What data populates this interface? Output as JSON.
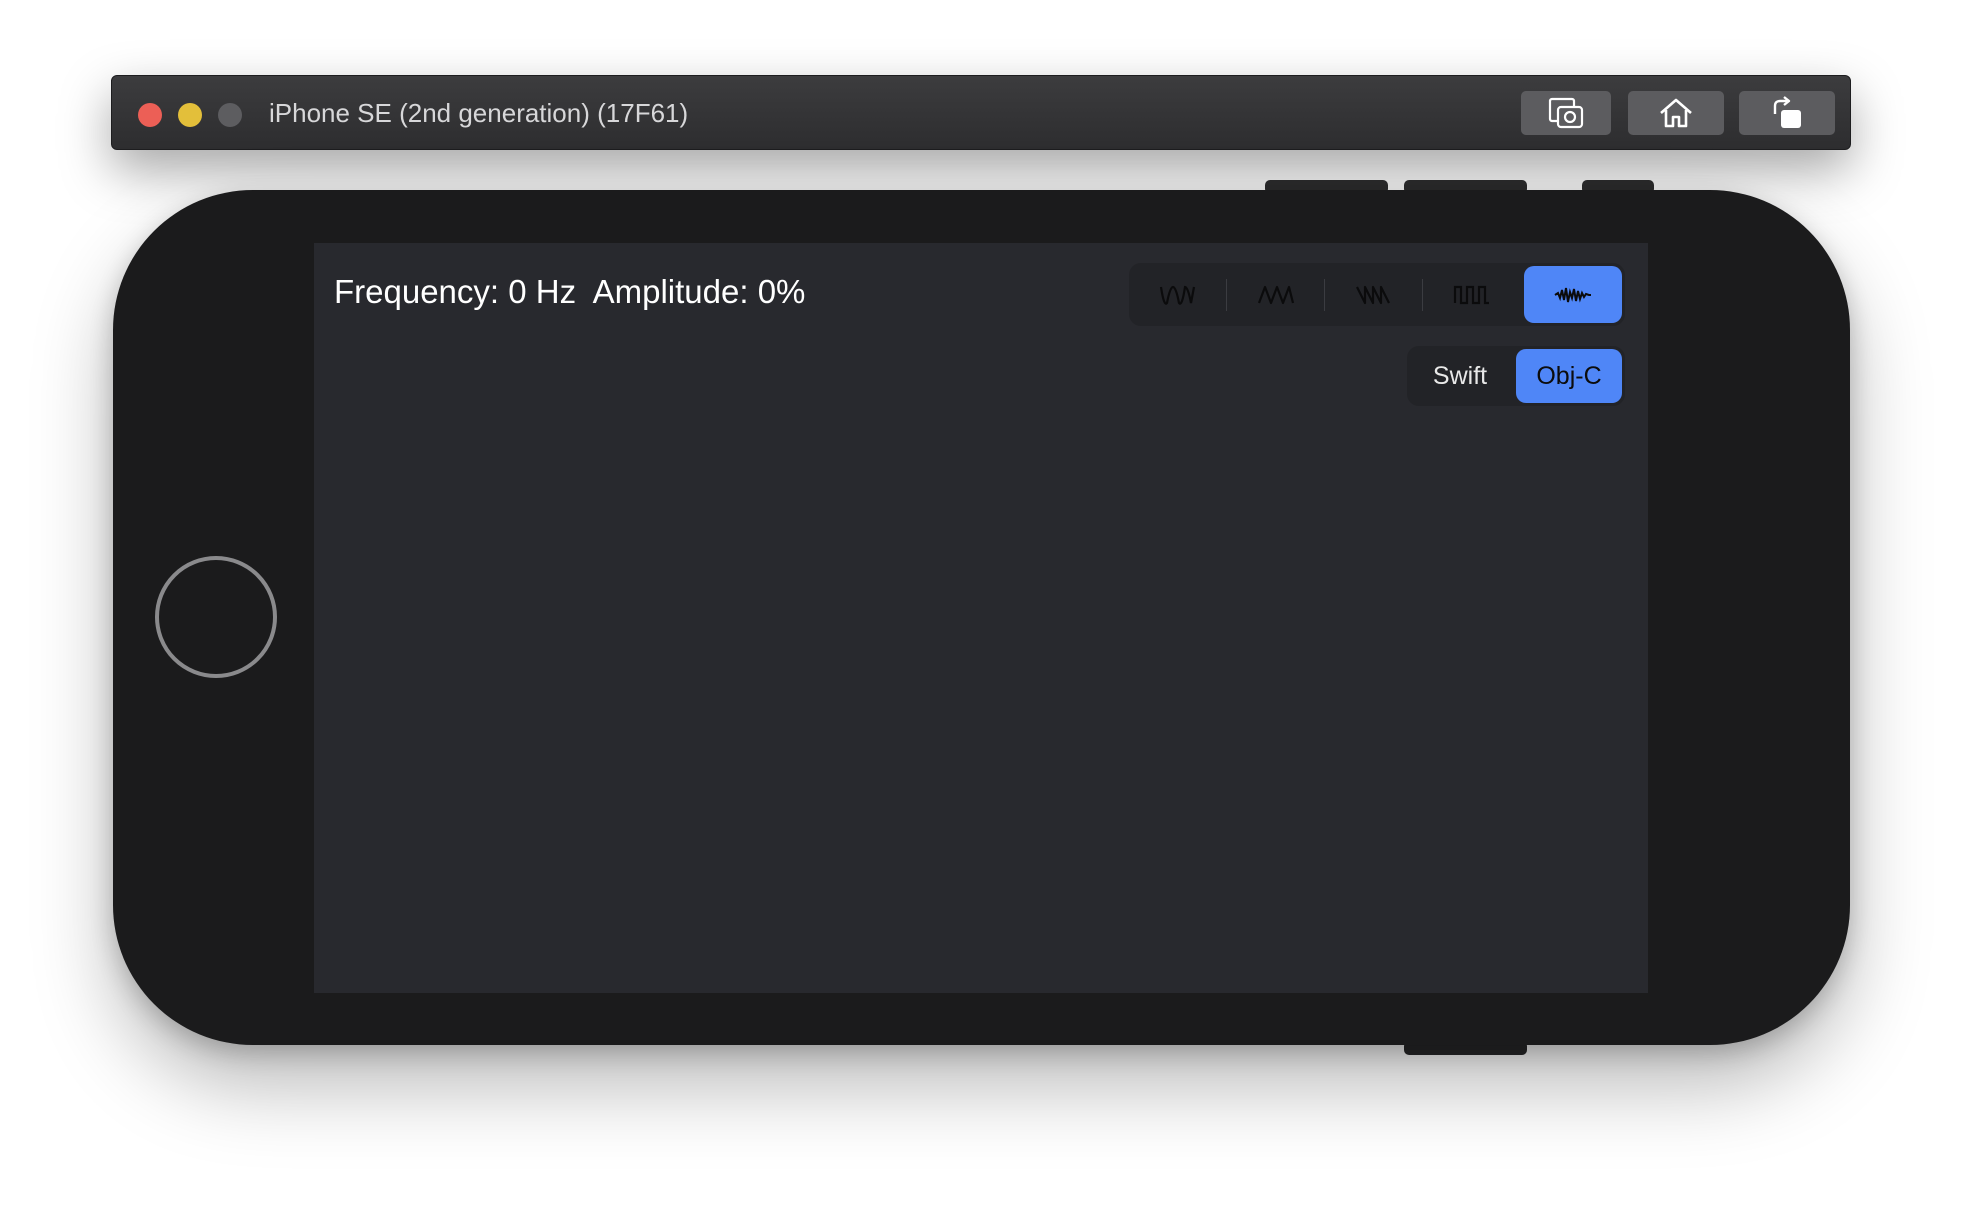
{
  "window": {
    "title": "iPhone SE (2nd generation) (17F61)",
    "toolbar": [
      {
        "name": "screenshot",
        "icon": "camera-icon"
      },
      {
        "name": "home",
        "icon": "home-icon"
      },
      {
        "name": "rotate",
        "icon": "rotate-icon"
      }
    ]
  },
  "screen": {
    "readout": "Frequency: 0 Hz  Amplitude: 0%",
    "waveform_selector": {
      "options": [
        {
          "icon": "sine-wave-icon",
          "selected": false
        },
        {
          "icon": "triangle-wave-icon",
          "selected": false
        },
        {
          "icon": "sawtooth-wave-icon",
          "selected": false
        },
        {
          "icon": "square-wave-icon",
          "selected": false
        },
        {
          "icon": "noise-wave-icon",
          "selected": true
        }
      ]
    },
    "language_selector": {
      "options": [
        {
          "label": "Swift",
          "selected": false
        },
        {
          "label": "Obj-C",
          "selected": true
        }
      ]
    }
  },
  "colors": {
    "accent": "#4f86f7",
    "screen_background": "#28292e",
    "control_background": "#222327"
  }
}
